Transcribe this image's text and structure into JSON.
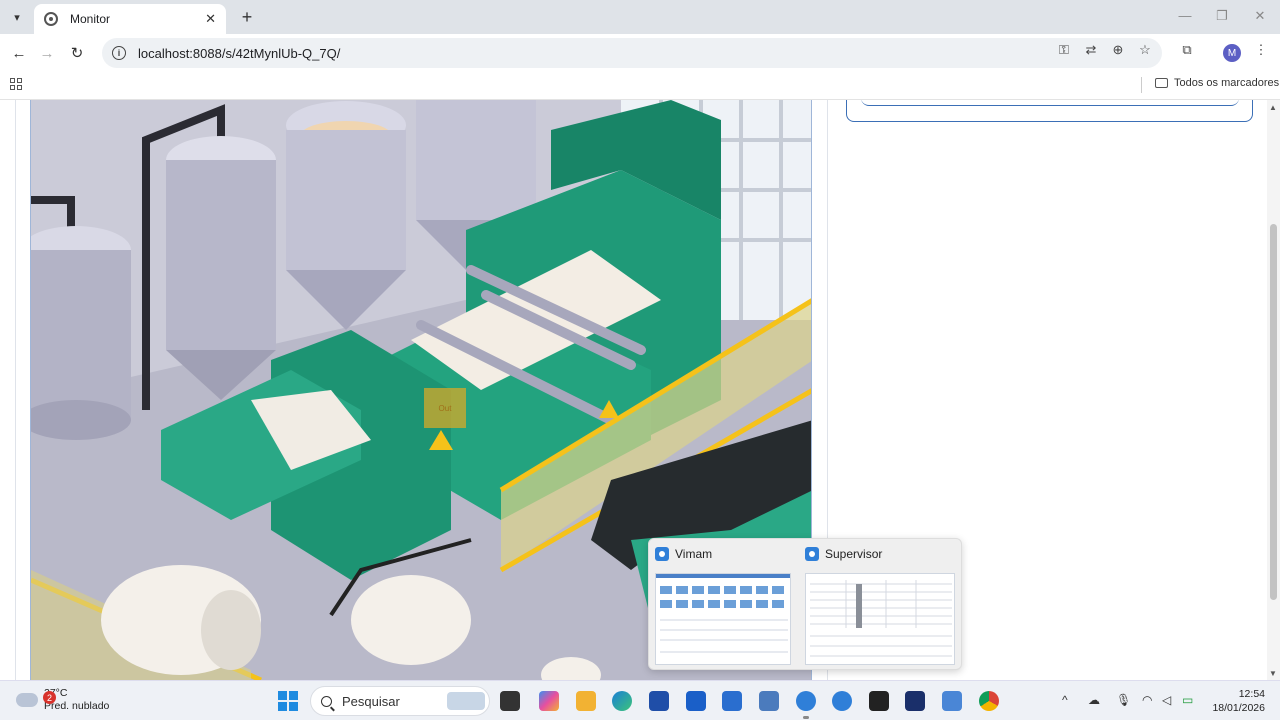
{
  "browser": {
    "tab_title": "Monitor",
    "url": "localhost:8088/s/42tMynlUb-Q_7Q/",
    "bookmarks_folder": "Todos os marcadores",
    "profile_initial": "M"
  },
  "scene": {
    "out_tag": "Out"
  },
  "preview": {
    "items": [
      {
        "label": "Vimam"
      },
      {
        "label": "Supervisor"
      }
    ]
  },
  "taskbar": {
    "weather_temp": "27°C",
    "weather_desc": "Pred. nublado",
    "weather_badge": "2",
    "search_label": "Pesquisar",
    "time": "12:54",
    "date": "18/01/2026"
  },
  "colors": {
    "accent": "#3b6fb6",
    "machine_green": "#1f9a78",
    "rail_yellow": "#f5c21a"
  }
}
